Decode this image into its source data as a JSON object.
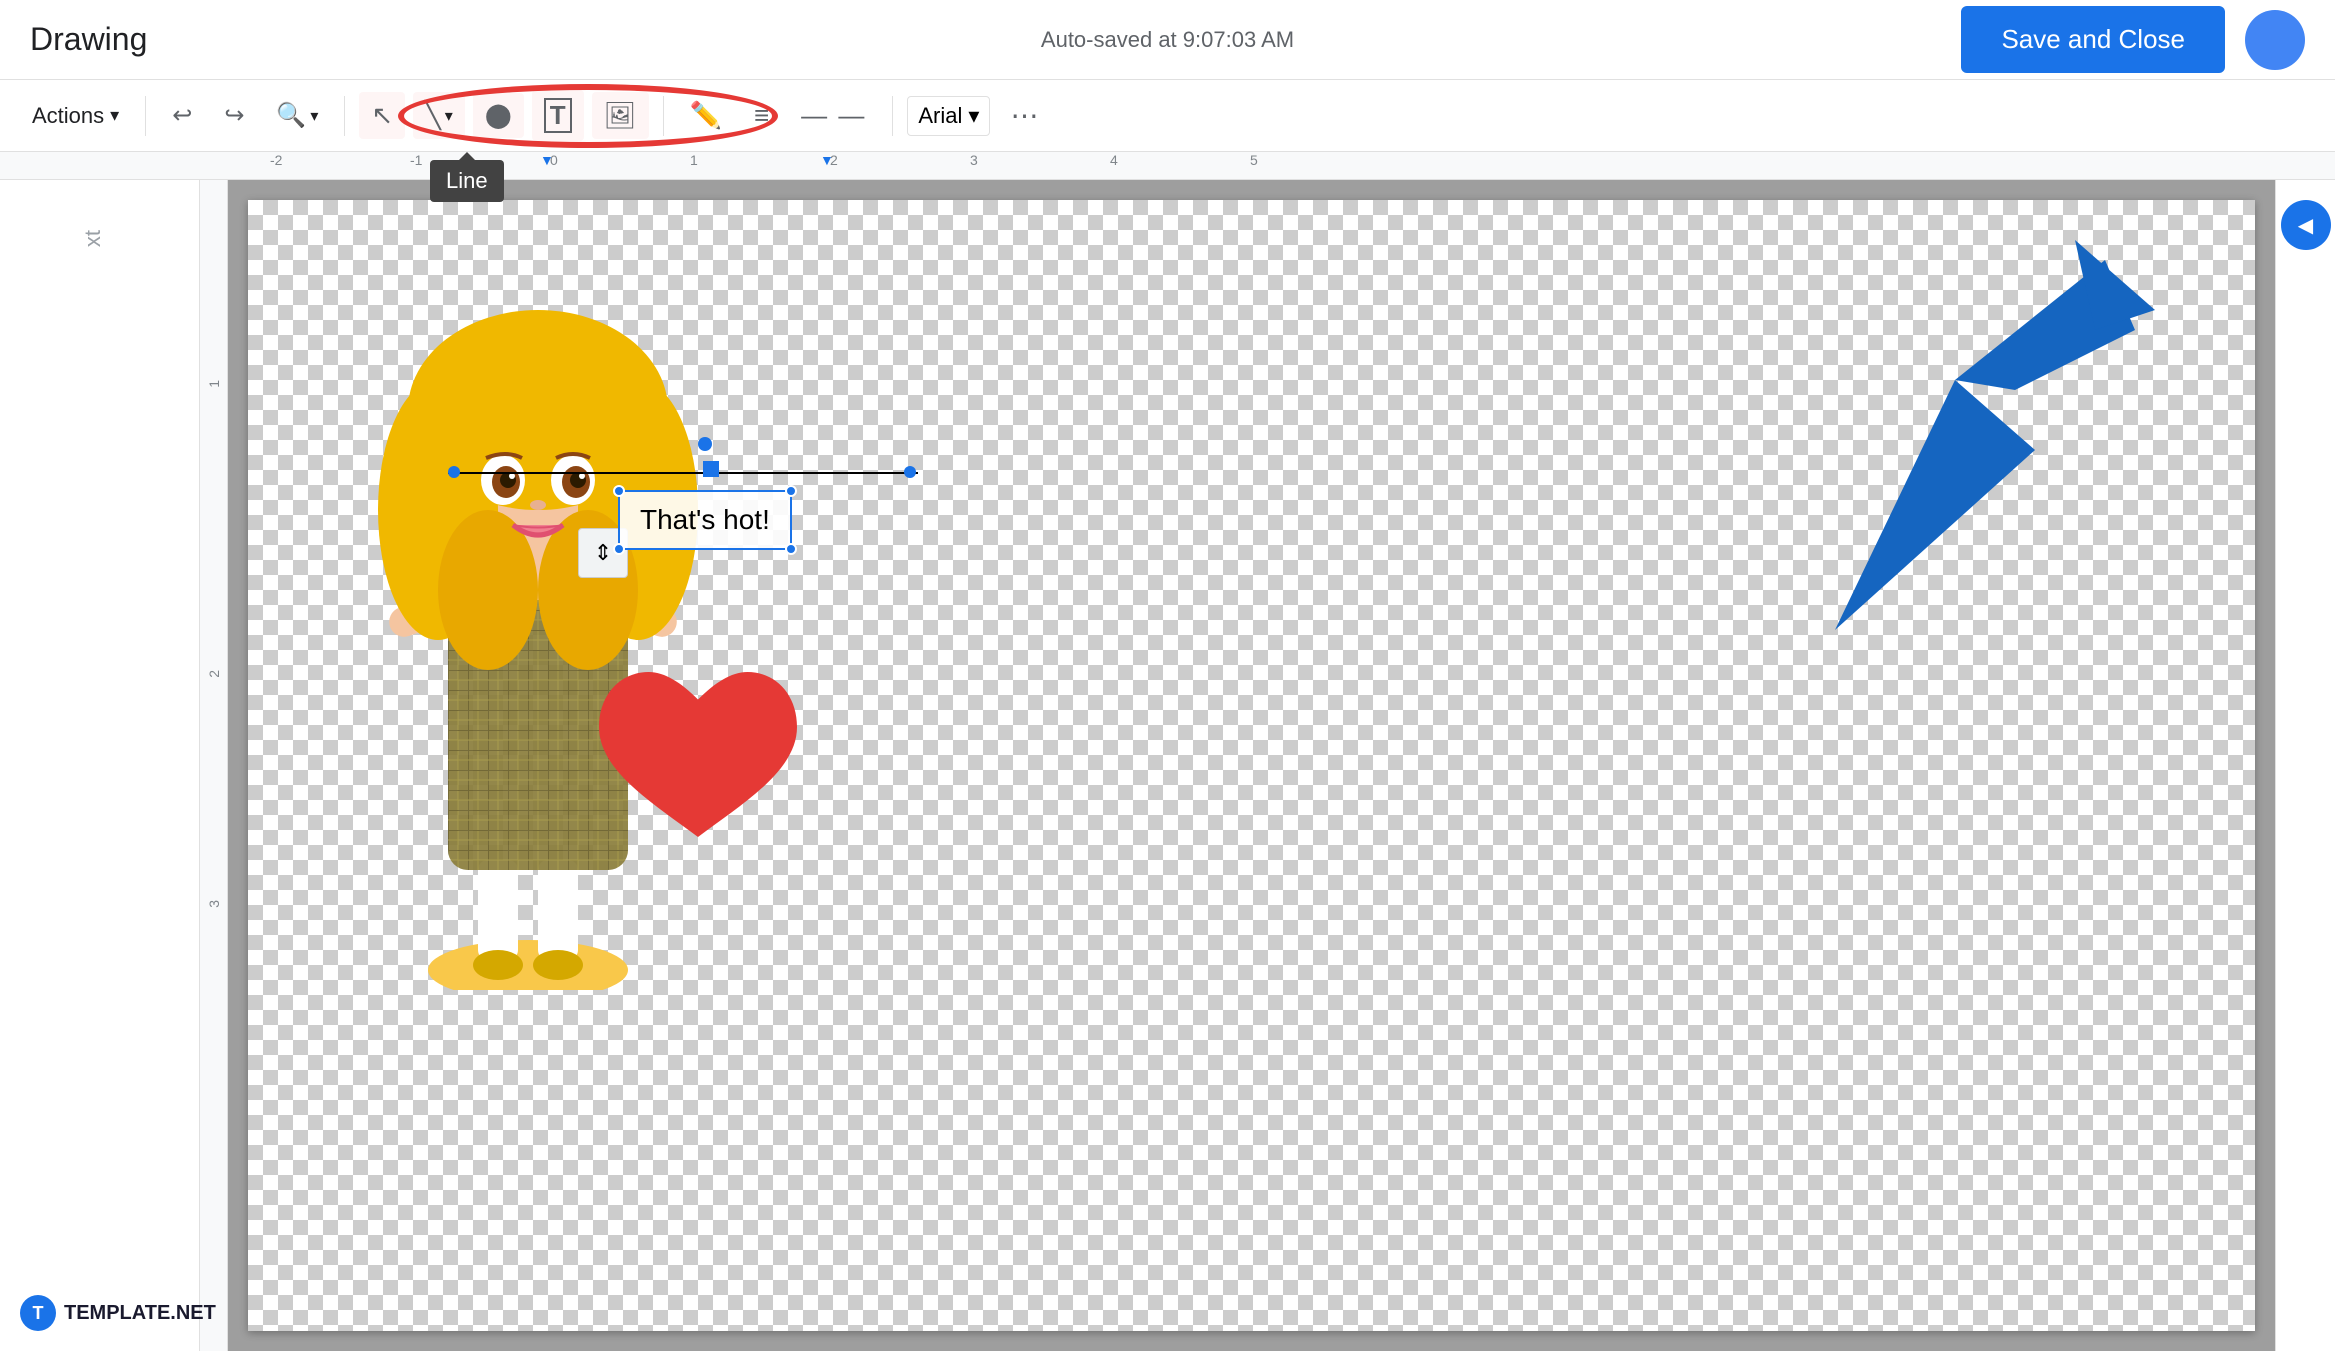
{
  "header": {
    "title": "Drawing",
    "autosave": "Auto-saved at 9:07:03 AM",
    "save_close_label": "Save and Close"
  },
  "toolbar": {
    "actions_label": "Actions",
    "undo_icon": "↩",
    "redo_icon": "↪",
    "zoom_icon": "⊕",
    "select_icon": "▲",
    "line_icon": "╲",
    "shape_icon": "⬤",
    "text_icon": "T",
    "image_icon": "🖼",
    "pen_icon": "✏",
    "line_weight_icon": "≡",
    "line_dash_icon": "⋯",
    "font_label": "Arial",
    "more_icon": "⋯",
    "tooltip_line": "Line"
  },
  "canvas": {
    "text_content": "That's hot!",
    "line_element": true,
    "heart_element": true
  },
  "annotations": {
    "red_circle": true,
    "blue_arrow": true
  },
  "watermark": {
    "logo": "T",
    "text": "TEMPLATE.NET"
  },
  "ruler": {
    "h_marks": [
      "-2",
      "-1",
      "0",
      "1",
      "2",
      "3",
      "4",
      "5"
    ],
    "v_marks": [
      "1",
      "2",
      "3"
    ]
  }
}
